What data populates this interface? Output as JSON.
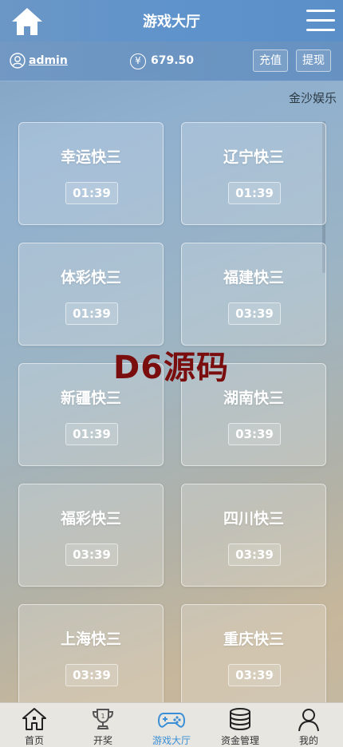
{
  "header": {
    "title": "游戏大厅",
    "home_icon": "home-icon",
    "menu_icon": "hamburger-menu-icon"
  },
  "user": {
    "name": "admin",
    "currency_symbol": "¥",
    "balance": "679.50",
    "recharge_label": "充值",
    "withdraw_label": "提现"
  },
  "marquee": {
    "text": "金沙娱乐"
  },
  "games": [
    {
      "name": "幸运快三",
      "time": "01:39"
    },
    {
      "name": "辽宁快三",
      "time": "01:39"
    },
    {
      "name": "体彩快三",
      "time": "01:39"
    },
    {
      "name": "福建快三",
      "time": "03:39"
    },
    {
      "name": "新疆快三",
      "time": "01:39"
    },
    {
      "name": "湖南快三",
      "time": "03:39"
    },
    {
      "name": "福彩快三",
      "time": "03:39"
    },
    {
      "name": "四川快三",
      "time": "03:39"
    },
    {
      "name": "上海快三",
      "time": "03:39"
    },
    {
      "name": "重庆快三",
      "time": "03:39"
    }
  ],
  "watermark": "D6源码",
  "nav": [
    {
      "label": "首页",
      "icon": "home-icon",
      "active": false
    },
    {
      "label": "开奖",
      "icon": "trophy-icon",
      "active": false
    },
    {
      "label": "游戏大厅",
      "icon": "gamepad-icon",
      "active": true
    },
    {
      "label": "资金管理",
      "icon": "coins-icon",
      "active": false
    },
    {
      "label": "我的",
      "icon": "user-icon",
      "active": false
    }
  ],
  "colors": {
    "header": "#5f93cb",
    "nav_active": "#3a8fd6",
    "watermark": "#7a0d0d",
    "nav_bg": "#e8e6e1"
  }
}
